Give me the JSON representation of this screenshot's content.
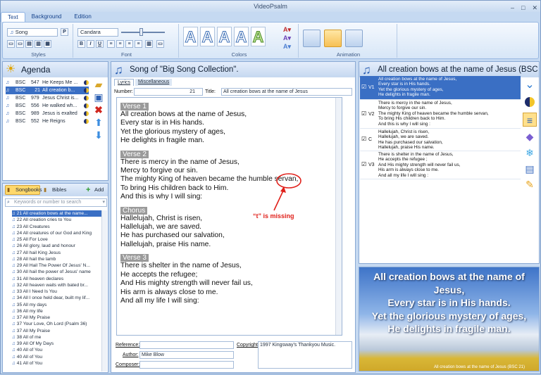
{
  "app": {
    "title": "VideoPsalm"
  },
  "ribbon_tabs": [
    "Text",
    "Background",
    "Edition"
  ],
  "ribbon": {
    "song_dropdown": "Song",
    "font_dropdown": "Candara",
    "group_styles": "Styles",
    "group_font": "Font",
    "group_colors": "Colors",
    "group_animation": "Animation",
    "bold": "B",
    "italic": "I",
    "underline": "U",
    "big_letter": "A"
  },
  "agenda": {
    "title": "Agenda",
    "items": [
      {
        "book": "BSC",
        "num": "547",
        "title": "He Keeps Me ..."
      },
      {
        "book": "BSC",
        "num": "21",
        "title": "All creation b..."
      },
      {
        "book": "BSC",
        "num": "979",
        "title": "Jesus Christ is..."
      },
      {
        "book": "BSC",
        "num": "556",
        "title": "He walked wh..."
      },
      {
        "book": "BSC",
        "num": "989",
        "title": "Jesus is exalted"
      },
      {
        "book": "BSC",
        "num": "552",
        "title": "He Reigns"
      }
    ]
  },
  "songbooks": {
    "tab_songbooks": "Songbooks",
    "tab_bibles": "Bibles",
    "add": "Add",
    "search_placeholder": "Keywords or number to search",
    "songs": [
      "21 All creation bows at the name...",
      "22 All creation cries to You",
      "23 All Creatures",
      "24 All creatures of our God and King",
      "25 All For Love",
      "26 All glory, laud and honour",
      "27 All hail King Jesus",
      "28 All hail the lamb",
      "29 All Hail The Power Of Jesus' N...",
      "30 All hail the power of Jesus' name",
      "31 All heaven declares",
      "32 All heaven waits with bated br...",
      "33 All I Need Is You",
      "34 All I once held dear, built my lif...",
      "35 All my days",
      "36 All my life",
      "37 All My Praise",
      "37 Your Love, Oh Lord (Psalm 36)",
      "37 All My Praise",
      "38 All of me",
      "39 All Of My Days",
      "40 All of You",
      "40 All of You",
      "41 All of You"
    ]
  },
  "song_editor": {
    "header": "Song of \"Big Song Collection\".",
    "tab_lyrics": "Lyrics",
    "tab_misc": "Miscellaneous",
    "number_label": "Number:",
    "number_value": "21",
    "title_label": "Title:",
    "title_value": "All creation bows at the name of Jesus",
    "verses": [
      {
        "label": "Verse 1",
        "lines": [
          "All creation bows at the name of Jesus,",
          "Every star is in His hands.",
          "Yet the glorious mystery of ages,",
          "He delights in fragile man."
        ]
      },
      {
        "label": "Verse 2",
        "lines": [
          "There is mercy in the name of Jesus,",
          "Mercy to forgive our sin.",
          "The mighty King of heaven became the humble servan,",
          "To bring His children back to Him.",
          "And this is why I will sing:"
        ]
      },
      {
        "label": "Chorus",
        "lines": [
          "Hallelujah, Christ is risen,",
          "Hallelujah, we are saved.",
          "He has purchased our salvation,",
          "Hallelujah, praise His name."
        ]
      },
      {
        "label": "Verse 3",
        "lines": [
          "There is shelter in the name of Jesus,",
          "He accepts the refugee;",
          "And His mighty strength will never fail us,",
          "His arm is always close to me.",
          "And all my life I will sing:"
        ]
      }
    ],
    "annotation": "“t” is missing",
    "reference_label": "Reference:",
    "reference_value": "",
    "author_label": "Author:",
    "author_value": "Mike Blow",
    "composer_label": "Composer:",
    "composer_value": "",
    "copyright_label": "Copyright:",
    "copyright_value": "1997 Kingsway's Thankyou Music."
  },
  "verses_panel": {
    "header": "All creation bows at the name of Jesus (BSC 21",
    "rows": [
      {
        "tag": "V1",
        "lines": [
          "All creation bows at the name of Jesus,",
          "Every star is in His hands.",
          "Yet the glorious mystery of ages,",
          "He delights in fragile man."
        ]
      },
      {
        "tag": "V2",
        "lines": [
          "There is mercy in the name of Jesus,",
          "Mercy to forgive our sin.",
          "The mighty King of heaven became the humble servan,",
          "To bring His children back to Him.",
          "And this is why I will sing :"
        ]
      },
      {
        "tag": "C",
        "lines": [
          "Hallelujah, Christ is risen,",
          "Hallelujah, we are saved.",
          "He has purchased our salvation,",
          "Hallelujah, praise His name."
        ]
      },
      {
        "tag": "V3",
        "lines": [
          "There is shelter in the name of Jesus,",
          "He accepts the refugee ;",
          "And His mighty strength will never fail us,",
          "His arm is always close to me.",
          "And all my life I will sing :"
        ]
      }
    ]
  },
  "preview": {
    "lines": [
      "All creation bows at the name of Jesus,",
      "Every star is in His hands.",
      "Yet the glorious mystery of ages,",
      "He delights in fragile man."
    ],
    "caption": "All creation bows at the name of Jesus (BSC 21)"
  }
}
